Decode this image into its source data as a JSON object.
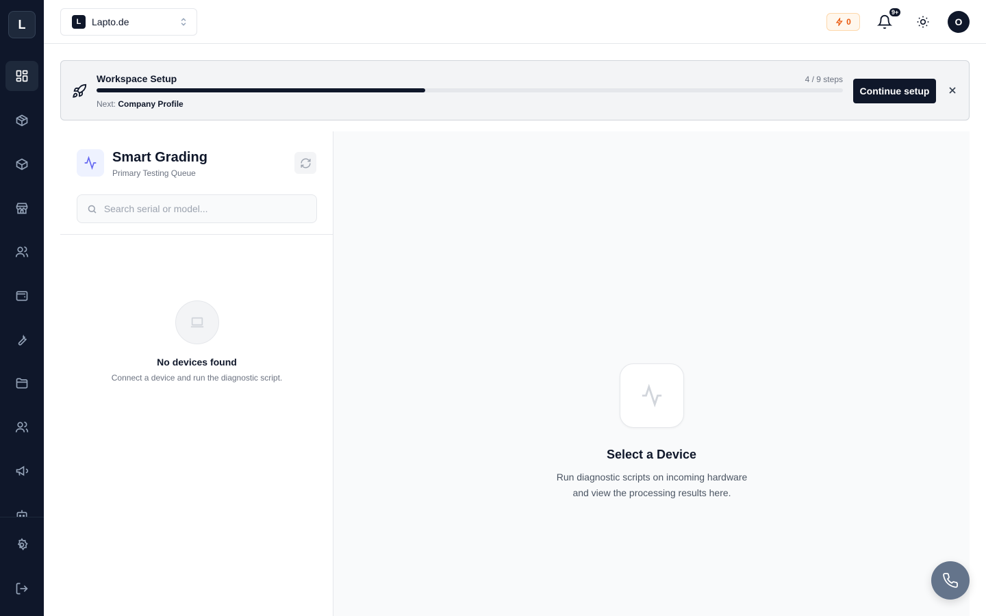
{
  "sidebar": {
    "logo_letter": "L",
    "items": [
      {
        "icon": "dashboard-icon",
        "active": true
      },
      {
        "icon": "box-icon"
      },
      {
        "icon": "package-icon"
      },
      {
        "icon": "store-icon"
      },
      {
        "icon": "users-icon"
      },
      {
        "icon": "wallet-icon"
      },
      {
        "icon": "wrench-icon"
      },
      {
        "icon": "folder-icon"
      },
      {
        "icon": "team-icon"
      },
      {
        "icon": "megaphone-icon"
      },
      {
        "icon": "bot-icon"
      }
    ],
    "bottom": [
      {
        "icon": "settings-icon"
      },
      {
        "icon": "logout-icon"
      }
    ]
  },
  "topbar": {
    "workspace_badge": "L",
    "workspace_name": "Lapto.de",
    "credits": "0",
    "notification_count": "9+",
    "avatar_letter": "O"
  },
  "setup_banner": {
    "title": "Workspace Setup",
    "steps": "4 / 9 steps",
    "progress_fraction": 0.44,
    "next_label": "Next:",
    "next_step": "Company Profile",
    "continue_label": "Continue setup"
  },
  "left_panel": {
    "title": "Smart Grading",
    "subtitle": "Primary Testing Queue",
    "search_placeholder": "Search serial or model...",
    "empty_title": "No devices found",
    "empty_subtitle": "Connect a device and run the diagnostic script."
  },
  "right_panel": {
    "title": "Select a Device",
    "subtitle": "Run diagnostic scripts on incoming hardware and view the processing results here."
  },
  "colors": {
    "sidebar_bg": "#0f172a",
    "accent": "#0f172a",
    "credits_orange": "#ea580c",
    "indigo": "#6366f1",
    "call_button": "#64748b"
  }
}
